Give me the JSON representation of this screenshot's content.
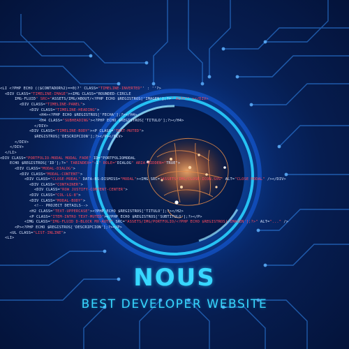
{
  "brand": {
    "title": "NOUS",
    "subtitle": "BEST DEVELOPER WEBSITE"
  },
  "code_lines": [
    {
      "indent": 0,
      "text": "<LI <?PHP ECHO (($CONTADOR%2)==0)?' CLASS=\"TIMELINE-INVERTED\"' : ''?>"
    },
    {
      "indent": 1,
      "text": "<DIV CLASS=\"TIMELINE-IMAGE\"><IMG CLASS=\"ROUNDED-CIRCLE"
    },
    {
      "indent": 3,
      "text": "IMG-FLUID\" SRC=\"ASSETS/IMG/ABOUT/<?PHP ECHO $REGISTROS['IMAGEN'];?>\" ALT=\"\" ></DIV>"
    },
    {
      "indent": 4,
      "text": "<DIV CLASS=\"TIMELINE-PANEL\">"
    },
    {
      "indent": 6,
      "text": "<DIV CLASS=\"TIMELINE-HEADING\">"
    },
    {
      "indent": 8,
      "text": "<H4><?PHP ECHO $REGISTROS['FECHA'];?></H4>"
    },
    {
      "indent": 8,
      "text": "<H4 CLASS=\"SUBHEADING\"><?PHP ECHO $REGISTROS['TITULO'];?></H4>"
    },
    {
      "indent": 7,
      "text": "</DIV>"
    },
    {
      "indent": 6,
      "text": "<DIV CLASS=\"TIMELINE-BODY\"><P CLASS=\"TEXT-MUTED\">"
    },
    {
      "indent": 7,
      "text": "$REGISTROS['DESCRIPCION'];?></P></DIV>"
    },
    {
      "indent": 3,
      "text": "</DIV>"
    },
    {
      "indent": 2,
      "text": "</DIV>"
    },
    {
      "indent": 1,
      "text": "</LI>"
    },
    {
      "indent": 0,
      "text": "<DIV CLASS=\"PORTFOLIO-MODAL MODAL FADE\" ID=\"PORTFOLIOMODAL"
    },
    {
      "indent": 2,
      "text": "ECHO $REGISTROS['ID'];?>\" TABINDEX=\"-1\" ROLE=\"DIALOG\" ARIA-HIDDEN=\"TRUE\">"
    },
    {
      "indent": 3,
      "text": "<DIV CLASS=\"MODAL-DIALOG\">"
    },
    {
      "indent": 4,
      "text": "<DIV CLASS=\"MODAL-CONTENT\">"
    },
    {
      "indent": 5,
      "text": "<DIV CLASS=\"CLOSE-MODAL\" DATA-BS-DISMISS=\"MODAL\"><IMG SRC=\"ASSETS/IMG/CLOSE-ICON.SVG\" ALT=\"CLOSE MODAL\" /></DIV>"
    },
    {
      "indent": 6,
      "text": "<DIV CLASS=\"CONTAINER\">"
    },
    {
      "indent": 7,
      "text": "<DIV CLASS=\"ROW JUSTIFY-CONTENT-CENTER\">"
    },
    {
      "indent": 6,
      "text": "<DIV CLASS=\"COL-LG-8\">"
    },
    {
      "indent": 6,
      "text": "<DIV CLASS=\"MODAL-BODY\">"
    },
    {
      "indent": 7,
      "text": "<!-- PROJECT DETAILS-->"
    },
    {
      "indent": 6,
      "text": "<H2 CLASS=\"TEXT-UPPERCASE\"><?PHP ECHO $REGISTROS['TITULO'];?></H2>"
    },
    {
      "indent": 6,
      "text": "<P CLASS=\"ITEM-INTRO TEXT-MUTED\"><?PHP ECHO $REGISTROS['SUBTITULO'];?></P>"
    },
    {
      "indent": 5,
      "text": "<IMG CLASS=\"IMG-FLUID D-BLOCK MX-AUTO\" SRC=\"ASSETS/IMG/PORTFOLIO/<?PHP ECHO $REGISTROS['IMAGEN'];?>\" ALT=\"...\" />"
    },
    {
      "indent": 3,
      "text": "<P><?PHP ECHO $REGISTROS['DESCRIPCION'];?></P>"
    },
    {
      "indent": 2,
      "text": "<UL CLASS=\"LIST-INLINE\">"
    },
    {
      "indent": 1,
      "text": "<LI>"
    }
  ],
  "colors": {
    "accent": "#37d7ff",
    "code_text": "#d9e6ff",
    "code_highlight": "#ff4b5e",
    "background": "#061d50"
  }
}
